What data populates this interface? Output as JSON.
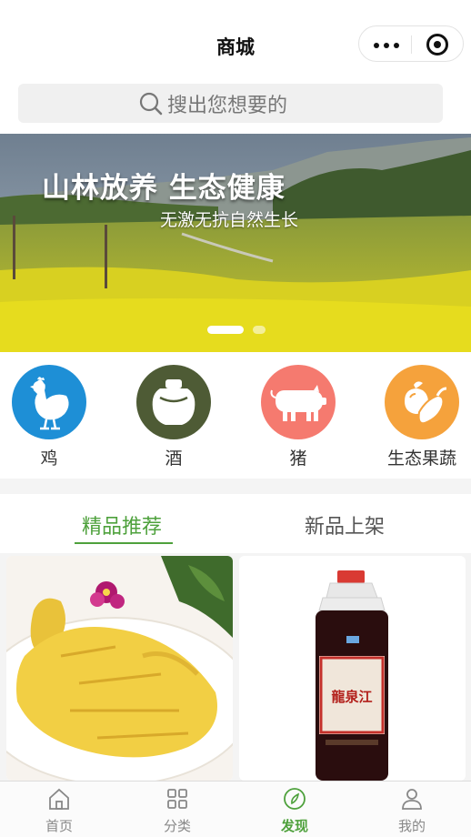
{
  "nav": {
    "title": "商城"
  },
  "search": {
    "placeholder": "搜出您想要的"
  },
  "banner": {
    "title": "山林放养 生态健康",
    "subtitle": "无激无抗自然生长",
    "slide_count": 2,
    "active_slide": 1
  },
  "categories": [
    {
      "label": "鸡",
      "icon": "chicken-icon",
      "color": "#1e8fd6"
    },
    {
      "label": "酒",
      "icon": "wine-jar-icon",
      "color": "#4e5b35"
    },
    {
      "label": "猪",
      "icon": "pig-icon",
      "color": "#f57a6f"
    },
    {
      "label": "生态果蔬",
      "icon": "vegetables-icon",
      "color": "#f5a23c"
    }
  ],
  "tabs": [
    {
      "label": "精品推荐",
      "active": true
    },
    {
      "label": "新品上架",
      "active": false
    }
  ],
  "products": [
    {
      "image": "chicken-dish-image",
      "bottle_label": ""
    },
    {
      "image": "liquor-bottle-image",
      "bottle_label": "龍泉江"
    }
  ],
  "tabbar": [
    {
      "label": "首页",
      "icon": "home-icon",
      "active": false
    },
    {
      "label": "分类",
      "icon": "grid-icon",
      "active": false
    },
    {
      "label": "发现",
      "icon": "compass-icon",
      "active": true
    },
    {
      "label": "我的",
      "icon": "user-icon",
      "active": false
    }
  ],
  "colors": {
    "accent": "#4ea13c",
    "background": "#f4f4f4"
  }
}
